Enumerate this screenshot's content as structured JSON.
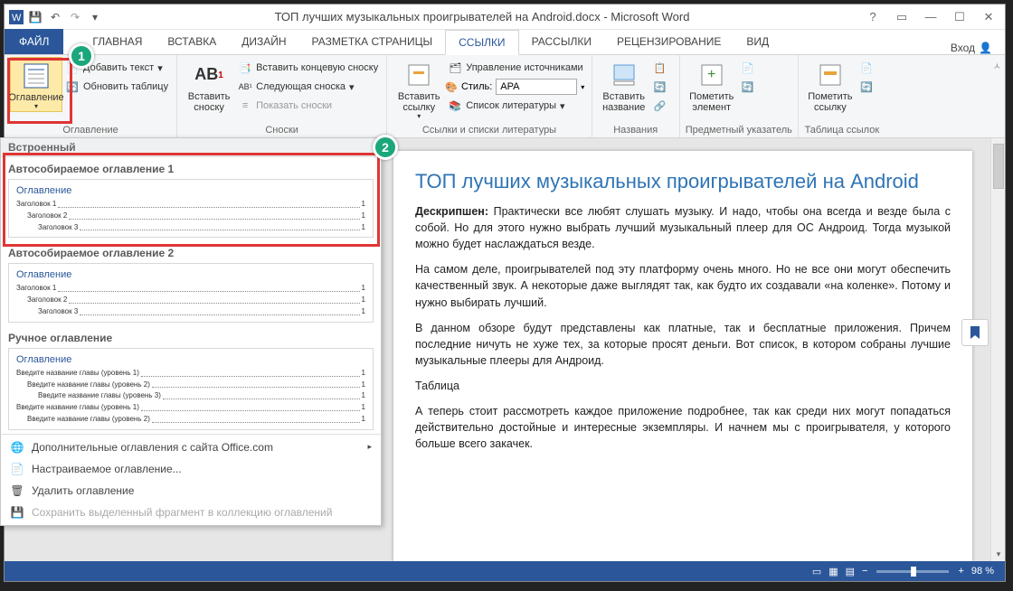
{
  "title": "ТОП лучших музыкальных проигрывателей на Android.docx - Microsoft Word",
  "tabs": {
    "file": "ФАЙЛ",
    "items": [
      "ГЛАВНАЯ",
      "ВСТАВКА",
      "ДИЗАЙН",
      "РАЗМЕТКА СТРАНИЦЫ",
      "ССЫЛКИ",
      "РАССЫЛКИ",
      "РЕЦЕНЗИРОВАНИЕ",
      "ВИД"
    ],
    "active_index": 4,
    "user": "Вход"
  },
  "ribbon": {
    "toc": {
      "big": "Оглавление",
      "add": "Добавить текст",
      "update": "Обновить таблицу"
    },
    "footnotes": {
      "big": "Вставить\nсноску",
      "ab": "AB",
      "end": "Вставить концевую сноску",
      "next": "Следующая сноска",
      "show": "Показать сноски",
      "group": "Сноски"
    },
    "citations": {
      "big": "Вставить\nссылку",
      "manage": "Управление источниками",
      "style_lbl": "Стиль:",
      "style_val": "APA",
      "bib": "Список литературы",
      "group": "Ссылки и списки литературы"
    },
    "captions": {
      "big": "Вставить\nназвание",
      "group": "Названия"
    },
    "index": {
      "big": "Пометить\nэлемент",
      "group": "Предметный указатель"
    },
    "toa": {
      "big": "Пометить\nссылку",
      "group": "Таблица ссылок"
    }
  },
  "dropdown": {
    "header": "Встроенный",
    "sections": [
      {
        "title": "Автособираемое оглавление 1",
        "preview_title": "Оглавление",
        "lines": [
          {
            "t": "Заголовок 1",
            "p": "1",
            "i": 0
          },
          {
            "t": "Заголовок 2",
            "p": "1",
            "i": 1
          },
          {
            "t": "Заголовок 3",
            "p": "1",
            "i": 2
          }
        ]
      },
      {
        "title": "Автособираемое оглавление 2",
        "preview_title": "Оглавление",
        "lines": [
          {
            "t": "Заголовок 1",
            "p": "1",
            "i": 0
          },
          {
            "t": "Заголовок 2",
            "p": "1",
            "i": 1
          },
          {
            "t": "Заголовок 3",
            "p": "1",
            "i": 2
          }
        ]
      },
      {
        "title": "Ручное оглавление",
        "preview_title": "Оглавление",
        "lines": [
          {
            "t": "Введите название главы (уровень 1)",
            "p": "1",
            "i": 0
          },
          {
            "t": "Введите название главы (уровень 2)",
            "p": "1",
            "i": 1
          },
          {
            "t": "Введите название главы (уровень 3)",
            "p": "1",
            "i": 2
          },
          {
            "t": "Введите название главы (уровень 1)",
            "p": "1",
            "i": 0
          },
          {
            "t": "Введите название главы (уровень 2)",
            "p": "1",
            "i": 1
          }
        ]
      }
    ],
    "menu": [
      {
        "t": "Дополнительные оглавления с сайта Office.com",
        "icon": "globe",
        "disabled": false
      },
      {
        "t": "Настраиваемое оглавление...",
        "icon": "doc",
        "disabled": false
      },
      {
        "t": "Удалить оглавление",
        "icon": "del",
        "disabled": false
      },
      {
        "t": "Сохранить выделенный фрагмент в коллекцию оглавлений",
        "icon": "save",
        "disabled": true
      }
    ]
  },
  "document": {
    "h1": "ТОП лучших музыкальных проигрывателей на Android",
    "p1_b": "Дескрипшен:",
    "p1": " Практически все любят слушать музыку. И надо, чтобы она всегда и везде была с собой. Но для этого нужно выбрать лучший музыкальный плеер для ОС Андроид. Тогда музыкой можно будет наслаждаться везде.",
    "p2": "На самом деле, проигрывателей под эту платформу очень много. Но не все они могут обеспечить качественный звук. А некоторые даже выглядят так, как будто их создавали «на коленке». Потому и нужно выбирать лучший.",
    "p3": "В данном обзоре будут представлены как платные, так и бесплатные приложения. Причем последние ничуть не хуже тех, за которые просят деньги. Вот список, в котором собраны лучшие музыкальные плееры для Андроид.",
    "p4": "Таблица",
    "p5": "А теперь стоит рассмотреть каждое приложение подробнее, так как среди них могут попадаться действительно достойные и интересные экземпляры. И начнем мы с проигрывателя, у которого больше всего закачек."
  },
  "status": {
    "zoom": "98 %"
  },
  "callouts": {
    "c1": "1",
    "c2": "2"
  }
}
